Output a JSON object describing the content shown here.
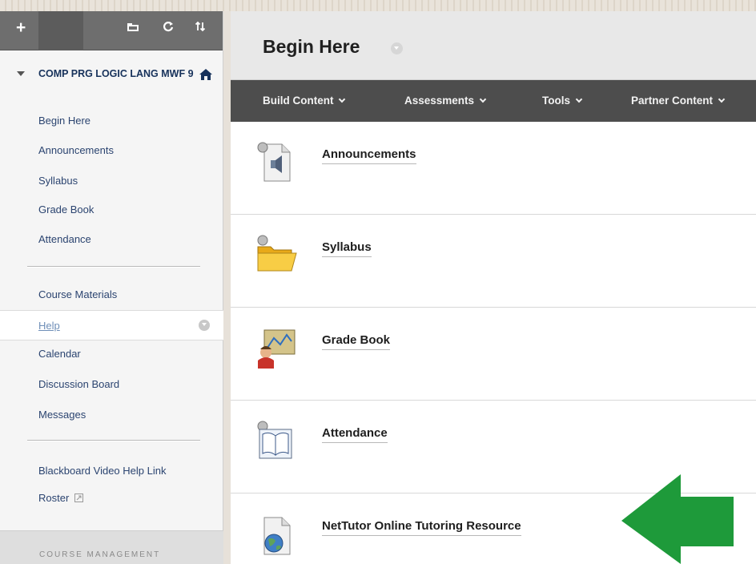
{
  "toolbar": {
    "add_icon": "plus-icon",
    "tools": [
      "folder-icon",
      "refresh-icon",
      "sort-icon"
    ]
  },
  "course": {
    "title": "COMP PRG LOGIC LANG MWF 9"
  },
  "sidebar": {
    "items": [
      {
        "label": "Begin Here"
      },
      {
        "label": "Announcements"
      },
      {
        "label": "Syllabus"
      },
      {
        "label": "Grade Book"
      },
      {
        "label": "Attendance"
      },
      {
        "label": "Course Materials"
      },
      {
        "label": "Help"
      },
      {
        "label": "Calendar"
      },
      {
        "label": "Discussion Board"
      },
      {
        "label": "Messages"
      },
      {
        "label": "Blackboard Video Help Link"
      },
      {
        "label": "Roster"
      }
    ],
    "management_label": "COURSE MANAGEMENT"
  },
  "main": {
    "page_title": "Begin Here",
    "actions": [
      {
        "label": "Build Content"
      },
      {
        "label": "Assessments"
      },
      {
        "label": "Tools"
      },
      {
        "label": "Partner Content"
      }
    ],
    "items": [
      {
        "title": "Announcements",
        "icon": "speaker-document-icon"
      },
      {
        "title": "Syllabus",
        "icon": "folder-icon"
      },
      {
        "title": "Grade Book",
        "icon": "gradebook-icon"
      },
      {
        "title": "Attendance",
        "icon": "book-icon"
      },
      {
        "title": "NetTutor Online Tutoring Resource",
        "icon": "globe-document-icon"
      }
    ]
  },
  "colors": {
    "accent_arrow": "#1e9a3a",
    "action_bar": "#4d4d4d",
    "link": "#2b4470"
  }
}
